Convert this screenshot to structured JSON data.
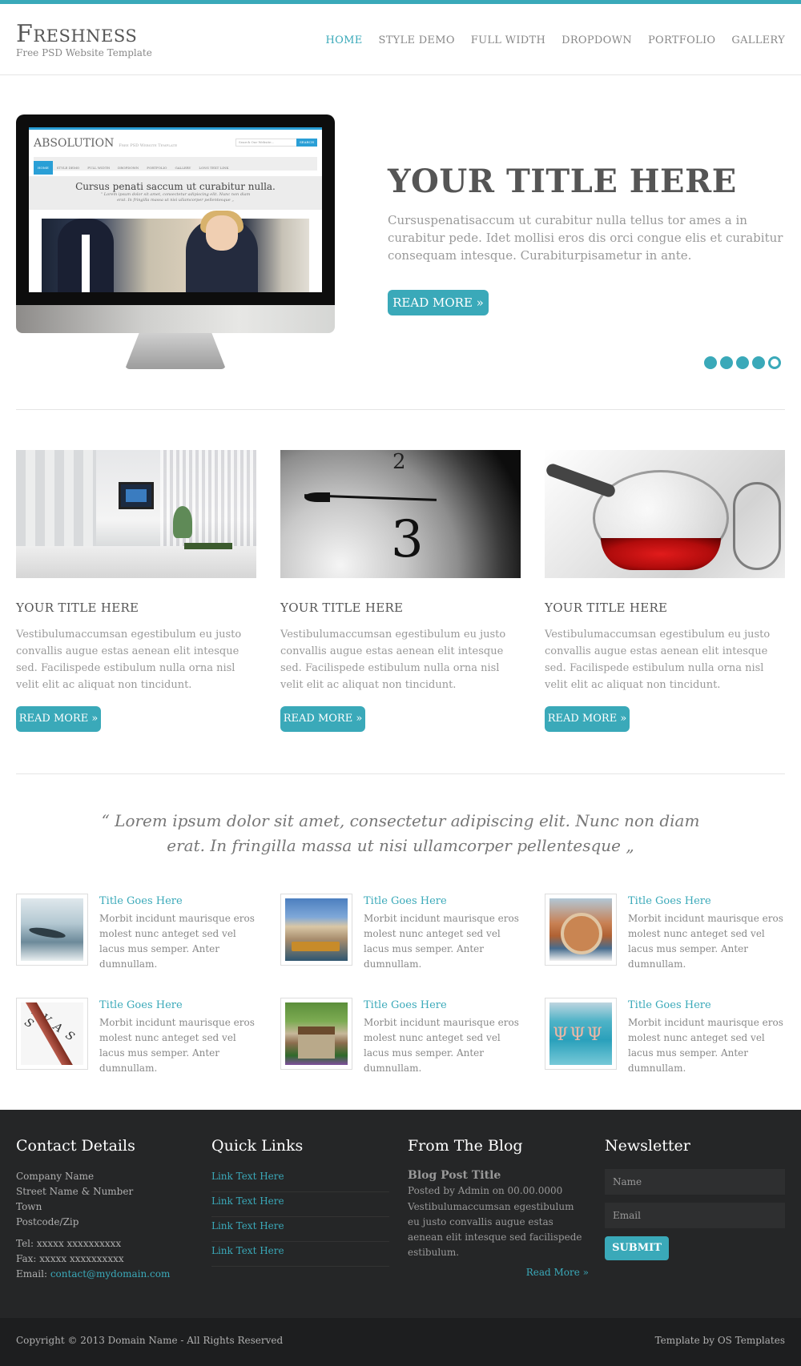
{
  "header": {
    "logo_title": "Freshness",
    "logo_tagline": "Free PSD Website Template",
    "nav": [
      "HOME",
      "STYLE DEMO",
      "FULL WIDTH",
      "DROPDOWN",
      "PORTFOLIO",
      "GALLERY"
    ],
    "active_nav": "HOME"
  },
  "hero": {
    "title": "YOUR TITLE HERE",
    "text": "Cursuspenatisaccum ut curabitur nulla tellus tor ames a in curabitur pede. Idet mollisi eros dis orci congue elis et curabitur consequam intesque. Curabiturpisametur in ante.",
    "button": "READ MORE »",
    "slides_total": 5,
    "current_slide": 5,
    "screen": {
      "logo": "ABSOLUTION",
      "tagline": "Free PSD Website Template",
      "search_placeholder": "Search Our Website...",
      "search_button": "SEARCH",
      "nav": [
        "HOME",
        "STYLE DEMO",
        "FULL WIDTH",
        "DROPDOWN",
        "PORTFOLIO",
        "GALLERY",
        "LONG TEXT LINK"
      ],
      "heading": "Cursus penati saccum ut curabitur nulla.",
      "quote_line1": "“ Lorem ipsum dolor sit amet, consectetur adipiscing elit. Nunc non diam",
      "quote_line2": "erat. In fringilla massa ut nisi ullamcorper pellentesque „"
    }
  },
  "features": [
    {
      "title": "YOUR TITLE HERE",
      "text": "Vestibulumaccumsan egestibulum eu justo convallis augue estas aenean elit intesque sed. Facilispede estibulum nulla orna nisl velit elit ac aliquat non tincidunt.",
      "button": "READ MORE »"
    },
    {
      "title": "YOUR TITLE HERE",
      "text": "Vestibulumaccumsan egestibulum eu justo convallis augue estas aenean elit intesque sed. Facilispede estibulum nulla orna nisl velit elit ac aliquat non tincidunt.",
      "button": "READ MORE »"
    },
    {
      "title": "YOUR TITLE HERE",
      "text": "Vestibulumaccumsan egestibulum eu justo convallis augue estas aenean elit intesque sed. Facilispede estibulum nulla orna nisl velit elit ac aliquat non tincidunt.",
      "button": "READ MORE »"
    }
  ],
  "quote": "“ Lorem ipsum dolor sit amet, consectetur adipiscing elit. Nunc non diam erat. In fringilla massa ut nisi ullamcorper pellentesque „",
  "items": [
    {
      "title": "Title Goes Here",
      "text": "Morbit incidunt maurisque eros molest nunc anteget sed vel lacus mus semper. Anter dumnullam."
    },
    {
      "title": "Title Goes Here",
      "text": "Morbit incidunt maurisque eros molest nunc anteget sed vel lacus mus semper. Anter dumnullam."
    },
    {
      "title": "Title Goes Here",
      "text": "Morbit incidunt maurisque eros molest nunc anteget sed vel lacus mus semper. Anter dumnullam."
    },
    {
      "title": "Title Goes Here",
      "text": "Morbit incidunt maurisque eros molest nunc anteget sed vel lacus mus semper. Anter dumnullam."
    },
    {
      "title": "Title Goes Here",
      "text": "Morbit incidunt maurisque eros molest nunc anteget sed vel lacus mus semper. Anter dumnullam."
    },
    {
      "title": "Title Goes Here",
      "text": "Morbit incidunt maurisque eros molest nunc anteget sed vel lacus mus semper. Anter dumnullam."
    }
  ],
  "footer": {
    "contact": {
      "title": "Contact Details",
      "company": "Company Name",
      "street": "Street Name & Number",
      "town": "Town",
      "postcode": "Postcode/Zip",
      "tel": "Tel: xxxxx xxxxxxxxxx",
      "fax": "Fax: xxxxx xxxxxxxxxx",
      "email_label": "Email: ",
      "email": "contact@mydomain.com"
    },
    "quick_links": {
      "title": "Quick Links",
      "links": [
        "Link Text Here",
        "Link Text Here",
        "Link Text Here",
        "Link Text Here"
      ]
    },
    "blog": {
      "title": "From The Blog",
      "post_title": "Blog Post Title",
      "meta": "Posted by Admin on 00.00.0000",
      "text": "Vestibulumaccumsan egestibulum eu justo convallis augue estas aenean elit intesque sed facilispede estibulum.",
      "read_more": "Read More »"
    },
    "newsletter": {
      "title": "Newsletter",
      "name_placeholder": "Name",
      "email_placeholder": "Email",
      "submit": "SUBMIT"
    },
    "copyright": "Copyright © 2013 Domain Name - All Rights Reserved",
    "credit": "Template by OS Templates"
  },
  "colors": {
    "accent": "#3aa9b9",
    "footer_bg": "#252627",
    "copyright_bg": "#1d1e1f"
  }
}
